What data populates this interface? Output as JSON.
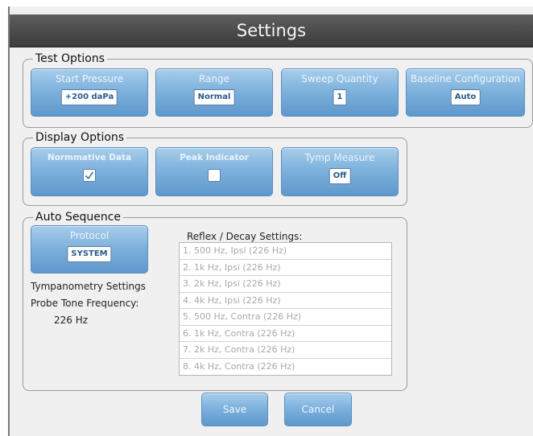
{
  "window": {
    "title": "Settings"
  },
  "test_options": {
    "legend": "Test Options",
    "start_pressure": {
      "label": "Start Pressure",
      "value": "+200 daPa"
    },
    "range": {
      "label": "Range",
      "value": "Normal"
    },
    "sweep_quantity": {
      "label": "Sweep Quantity",
      "value": "1"
    },
    "baseline_configuration": {
      "label": "Baseline Configuration",
      "value": "Auto"
    }
  },
  "display_options": {
    "legend": "Display Options",
    "normative_data": {
      "label": "Normmative Data",
      "checked": true
    },
    "peak_indicator": {
      "label": "Peak Indicator",
      "checked": false
    },
    "tymp_measure": {
      "label": "Tymp Measure",
      "value": "Off"
    }
  },
  "auto_sequence": {
    "legend": "Auto Sequence",
    "protocol": {
      "label": "Protocol",
      "value": "SYSTEM"
    },
    "tymp_settings_label": "Tympanometry Settings",
    "probe_tone_label": "Probe Tone Frequency:",
    "probe_tone_value": "226 Hz",
    "reflex_label": "Reflex / Decay Settings:",
    "reflex_items": [
      "1.  500 Hz, Ipsi (226 Hz)",
      "2.  1k Hz, Ipsi (226 Hz)",
      "3.  2k Hz, Ipsi (226 Hz)",
      "4.  4k Hz, Ipsi (226 Hz)",
      "5.  500 Hz, Contra (226 Hz)",
      "6.  1k Hz, Contra (226 Hz)",
      "7.  2k Hz, Contra (226 Hz)",
      "8.  4k Hz, Contra (226 Hz)"
    ]
  },
  "footer": {
    "save_label": "Save",
    "cancel_label": "Cancel"
  }
}
